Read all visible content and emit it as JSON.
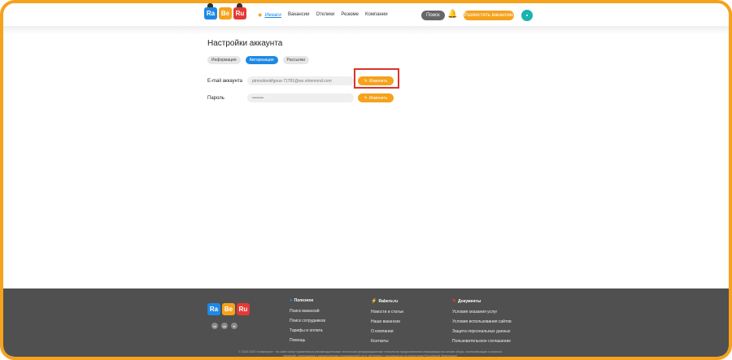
{
  "header": {
    "logo": [
      "Ra",
      "Be",
      "Ru"
    ],
    "city": "Ижевск",
    "nav": [
      "Вакансии",
      "Отклики",
      "Резюме",
      "Компании"
    ],
    "search_label": "Поиск",
    "post_vacancy_label": "Разместить вакансию"
  },
  "main": {
    "title": "Настройки аккаунта",
    "tabs": [
      {
        "label": "Информация",
        "active": false
      },
      {
        "label": "Авторизация",
        "active": true
      },
      {
        "label": "Рассылки",
        "active": false
      }
    ],
    "email_label": "E-mail аккаунта",
    "email_value": "ptmsobsnkfgous-71781@wu.virtemond.com",
    "password_label": "Пароль",
    "password_value": "••••••••",
    "change_label": "Изменить"
  },
  "footer": {
    "logo": [
      "Ra",
      "Be",
      "Ru"
    ],
    "socials": [
      "vk-icon",
      "ok-icon",
      "telegram-icon"
    ],
    "col1": {
      "title": "Полезное",
      "items": [
        "Поиск вакансий",
        "Поиск сотрудников",
        "Тарифы и оплата",
        "Помощь"
      ]
    },
    "col2": {
      "title": "Raberu.ru",
      "items": [
        "Новости и статьи",
        "Наши вакансии",
        "О компании",
        "Контакты"
      ]
    },
    "col3": {
      "title": "Документы",
      "items": [
        "Условия оказания услуг",
        "Условия использования сайтов",
        "Защита персональных данных",
        "Пользовательское соглашение"
      ]
    },
    "copyright": "© 2026 ООО «Алматрон» · на сайте могут применяться рекомендательные технологии (информационные технологии предоставления информации на основе сбора, систематизации и анализа сведений, относящихся к предпочтениям пользователей сети «Интернет», находящихся на территории Российской Федерации)"
  },
  "colors": {
    "accent": "#f5a21c",
    "primary": "#1e88e5",
    "footer_bg": "#505050",
    "highlight": "#d9342b"
  }
}
